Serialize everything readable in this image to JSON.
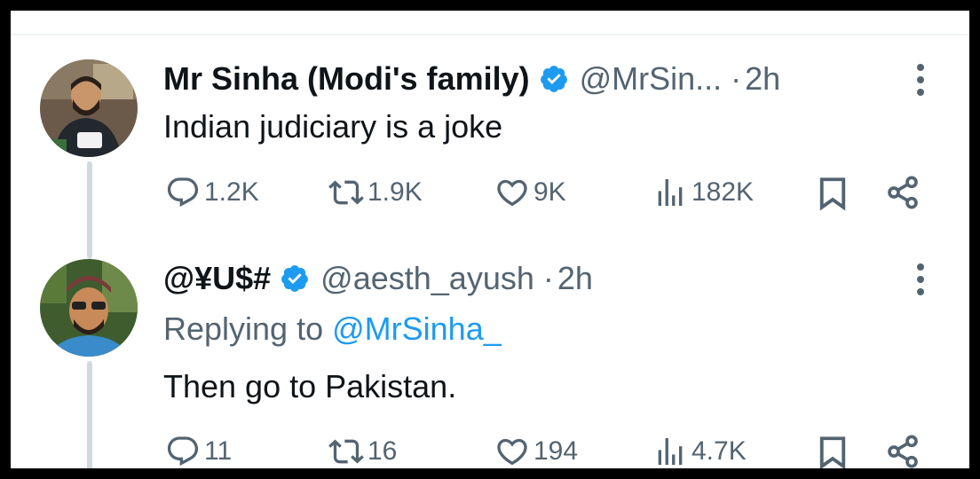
{
  "tweet1": {
    "name": "Mr Sinha (Modi's family)",
    "handle": "@MrSin...",
    "separator": "·",
    "time": "2h",
    "text": "Indian judiciary is a joke",
    "replies": "1.2K",
    "retweets": "1.9K",
    "likes": "9K",
    "views": "182K"
  },
  "tweet2": {
    "name": "@¥U$#",
    "handle": "@aesth_ayush",
    "separator": "·",
    "time": "2h",
    "replying_prefix": "Replying to",
    "replying_to": "@MrSinha_",
    "text": "Then go to Pakistan.",
    "replies": "11",
    "retweets": "16",
    "likes": "194",
    "views": "4.7K"
  },
  "icons": {
    "verified": "verified-badge-icon",
    "reply": "reply-icon",
    "retweet": "retweet-icon",
    "like": "heart-icon",
    "views": "views-icon",
    "bookmark": "bookmark-icon",
    "share": "share-icon",
    "more": "more-icon"
  },
  "colors": {
    "verified": "#1d9bf0",
    "mention": "#1d9bf0",
    "muted": "#536471",
    "text": "#0f1419",
    "thread_line": "#cfd9de"
  }
}
